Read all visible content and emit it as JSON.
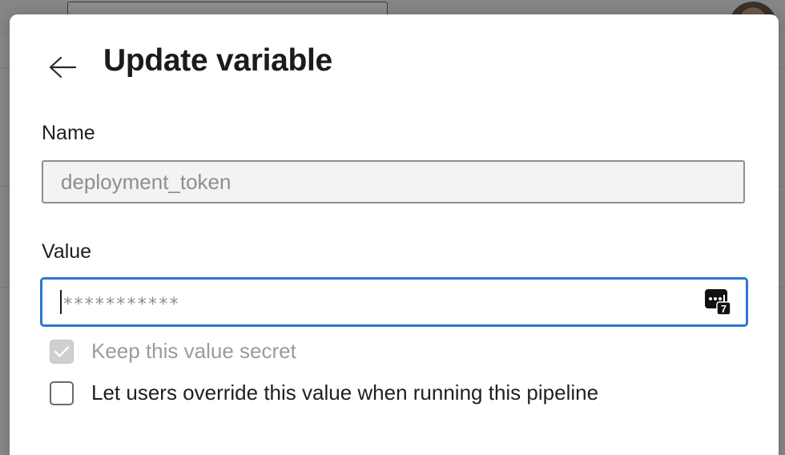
{
  "dialog": {
    "title": "Update variable",
    "back_icon": "arrow-left-icon"
  },
  "name_field": {
    "label": "Name",
    "value": "deployment_token",
    "disabled": true
  },
  "value_field": {
    "label": "Value",
    "masked_value": "***********",
    "focused": true,
    "password_manager_icon": "password-manager-icon",
    "password_manager_badge": "7"
  },
  "options": {
    "keep_secret": {
      "label": "Keep this value secret",
      "checked": true,
      "disabled": true
    },
    "allow_override": {
      "label": "Let users override this value when running this pipeline",
      "checked": false,
      "disabled": false
    }
  },
  "colors": {
    "focus_border": "#2c77d2",
    "disabled_text": "#9b9b9b"
  }
}
